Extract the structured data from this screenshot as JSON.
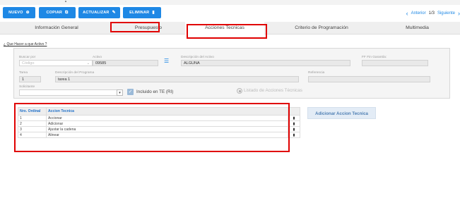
{
  "toolbar": {
    "nuevo_label": "NUEVO",
    "copiar_label": "COPIAR",
    "actualizar_label": "ACTUALIZAR",
    "eliminar_label": "ELIMINAR",
    "nav_prev": "Anterior",
    "nav_page": "1/3",
    "nav_next": "Siguiente"
  },
  "tabs": [
    {
      "label": "Información General"
    },
    {
      "label": "Presupuesto"
    },
    {
      "label": "Acciones Tecnicas"
    },
    {
      "label": "Criterio de Programación"
    },
    {
      "label": "Multimedia"
    }
  ],
  "section": {
    "title": "¿ Que Hacer a que Activo ?"
  },
  "form": {
    "buscar_por_label": "Buscar por",
    "buscar_por_placeholder": "Código",
    "activo_label": "Activo",
    "activo_value": "09585",
    "descripcion_activo_label": "Descripción del Activo",
    "descripcion_activo_value": "ALGUNA",
    "ff_fin_garantia_label": "FF Fin Garantía:",
    "tarea_label": "Tarea",
    "tarea_value": "1",
    "descripcion_programa_label": "Descripción del Programa",
    "descripcion_programa_value": "tarea 1",
    "referencia_label": "Referencia",
    "solicitante_label": "Solicitante",
    "incluido_label": "Incluido en TE (RI)",
    "listado_label": "Listado de Acciones Técnicas"
  },
  "table": {
    "headers": [
      "Nro. Ordinal",
      "Accion Tecnica"
    ],
    "rows": [
      {
        "ordinal": "1",
        "accion": "Accionar"
      },
      {
        "ordinal": "2",
        "accion": "Adicionar"
      },
      {
        "ordinal": "3",
        "accion": "Ajustar la cadena"
      },
      {
        "ordinal": "4",
        "accion": "Alinear"
      }
    ]
  },
  "add_button_label": "Adicionar Accion Tecnica",
  "colors": {
    "accent": "#1e88e5",
    "highlight": "#e00000",
    "panel": "#f5f5f5"
  },
  "icons": {
    "nuevo": "plus-circle-icon",
    "copiar": "copy-icon",
    "actualizar": "pencil-icon",
    "eliminar": "trash-icon",
    "prev": "chevron-left-icon",
    "next": "chevron-right-icon",
    "filter": "filter-icon",
    "delete_row": "trash-icon"
  }
}
